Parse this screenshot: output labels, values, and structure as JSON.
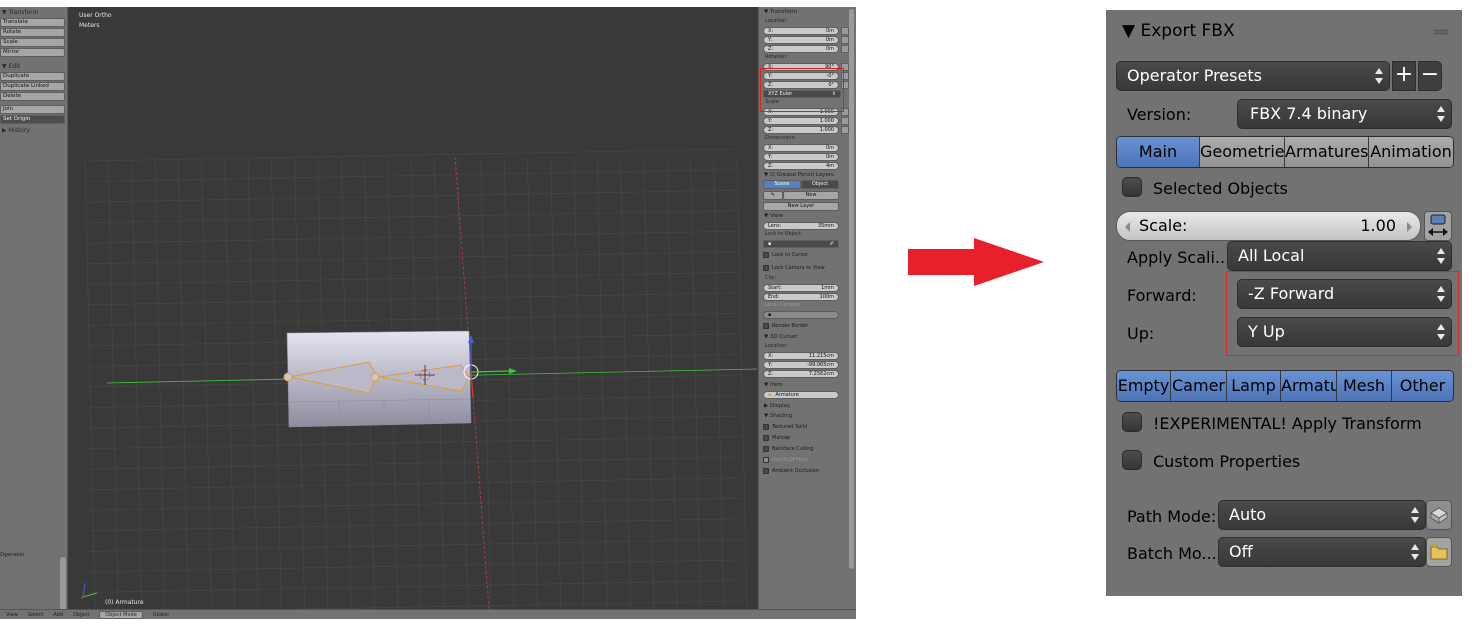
{
  "blender": {
    "toolshelf": {
      "transform_header": "▼ Transform",
      "transform_buttons": [
        "Translate",
        "Rotate",
        "Scale",
        "Mirror"
      ],
      "edit_header": "▼ Edit",
      "edit_buttons": [
        "Duplicate",
        "Duplicate Linked",
        "Delete"
      ],
      "join": "Join",
      "set_origin": "Set Origin",
      "history_header": "▶ History",
      "operator": "Operator"
    },
    "viewport": {
      "view_name": "User Ortho",
      "units": "Meters",
      "object_name": "(0) Armature"
    },
    "npanel": {
      "transform_header": "▼ Transform",
      "location_label": "Location:",
      "location": [
        {
          "axis": "X:",
          "value": "0m"
        },
        {
          "axis": "Y:",
          "value": "0m"
        },
        {
          "axis": "Z:",
          "value": "0m"
        }
      ],
      "rotation_label": "Rotation:",
      "rotation": [
        {
          "axis": "X:",
          "value": "90°"
        },
        {
          "axis": "Y:",
          "value": "-0°"
        },
        {
          "axis": "Z:",
          "value": "0°"
        }
      ],
      "rotation_mode": "XYZ Euler",
      "scale_label": "Scale:",
      "scale": [
        {
          "axis": "X:",
          "value": "1.000"
        },
        {
          "axis": "Y:",
          "value": "1.000"
        },
        {
          "axis": "Z:",
          "value": "1.000"
        }
      ],
      "dimensions_label": "Dimensions:",
      "dimensions": [
        {
          "axis": "X:",
          "value": "0m"
        },
        {
          "axis": "Y:",
          "value": "0m"
        },
        {
          "axis": "Z:",
          "value": "4m"
        }
      ],
      "grease_header": "▼ ☑ Grease Pencil Layers",
      "scene_tab": "Scene",
      "object_tab": "Object",
      "new_button": "New",
      "new_layer_button": "New Layer",
      "view_header": "▼ View",
      "lens_label": "Lens:",
      "lens_value": "35mm",
      "lock_to_object": "Lock to Object:",
      "lock_to_cursor": "Lock to Cursor",
      "lock_camera": "Lock Camera to View",
      "clip_label": "Clip:",
      "clip_start_label": "Start:",
      "clip_start_value": "1mm",
      "clip_end_label": "End:",
      "clip_end_value": "100m",
      "local_camera": "Local Camera:",
      "render_border": "Render Border",
      "cursor_header": "▼ 3D Cursor",
      "cursor_location_label": "Location:",
      "cursor": [
        {
          "axis": "X:",
          "value": "11.215cm"
        },
        {
          "axis": "Y:",
          "value": "-99.065cm"
        },
        {
          "axis": "Z:",
          "value": "7.2562cm"
        }
      ],
      "item_header": "▼ Item",
      "item_name": "Armature",
      "display_header": "▶ Display",
      "shading_header": "▼ Shading",
      "shading_options": [
        "Textured Solid",
        "Matcap",
        "Backface Culling",
        "Depth Of Field",
        "Ambient Occlusion"
      ]
    },
    "header": {
      "view": "View",
      "select": "Select",
      "add": "Add",
      "object": "Object",
      "mode": "Object Mode",
      "orientation": "Global"
    },
    "colors": {
      "x_axis": "#3fc43f",
      "y_axis": "#c43f3f",
      "highlight": "#e21d1d"
    }
  },
  "arrow": {
    "color": "#e8202a",
    "icon": "right-arrow-icon"
  },
  "export_fbx": {
    "title": "▼ Export FBX",
    "operator_presets": "Operator Presets",
    "version_label": "Version:",
    "version_value": "FBX 7.4 binary",
    "tabs": [
      "Main",
      "Geometrie",
      "Armatures",
      "Animation"
    ],
    "active_tab": "Main",
    "selected_objects": "Selected Objects",
    "scale_label": "Scale:",
    "scale_value": "1.00",
    "apply_scaling_label": "Apply Scali...",
    "apply_scaling_value": "All Local",
    "forward_label": "Forward:",
    "forward_value": "-Z Forward",
    "up_label": "Up:",
    "up_value": "Y Up",
    "object_types": [
      "Empty",
      "Camer",
      "Lamp",
      "Armatu",
      "Mesh",
      "Other"
    ],
    "apply_transform": "!EXPERIMENTAL! Apply Transform",
    "custom_properties": "Custom Properties",
    "path_mode_label": "Path Mode:",
    "path_mode_value": "Auto",
    "batch_mode_label": "Batch Mo...",
    "batch_mode_value": "Off",
    "colors": {
      "active_tab": "#5680c2",
      "highlight": "#d82a2a",
      "panel": "#727272"
    }
  }
}
